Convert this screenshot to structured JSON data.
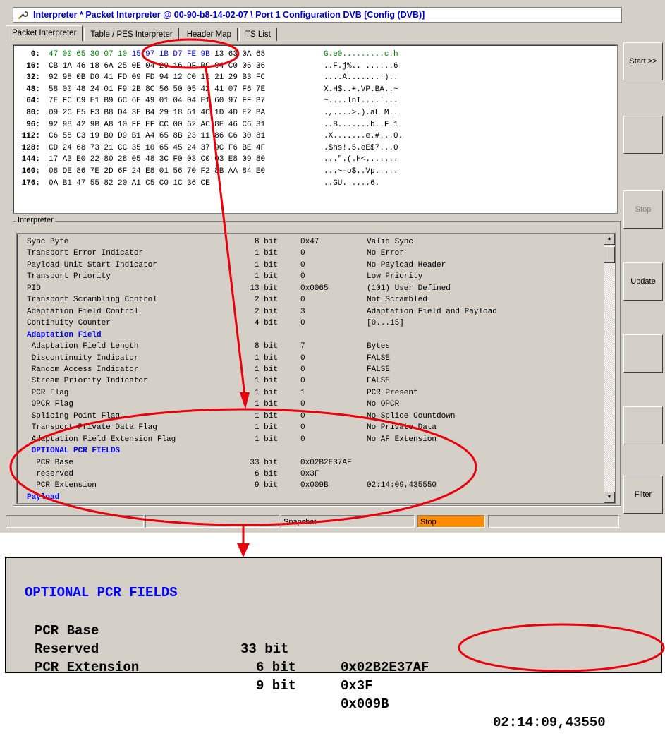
{
  "window": {
    "title": "Interpreter * Packet Interpreter @ 00-90-b8-14-02-07 \\ Port 1 Configuration DVB [Config (DVB)]",
    "tabs": [
      "Packet Interpreter",
      "Table / PES Interpreter",
      "Header Map",
      "TS List"
    ]
  },
  "hex_dump": [
    {
      "offset": "0:",
      "bytes": [
        "47",
        "00",
        "65",
        "30",
        "07",
        "10",
        "15",
        "97",
        "1B",
        "D7",
        "FE",
        "9B",
        "13",
        "63",
        "0A",
        "68"
      ],
      "ascii": "G.e0.........c.h"
    },
    {
      "offset": "16:",
      "bytes": [
        "CB",
        "1A",
        "46",
        "18",
        "6A",
        "25",
        "0E",
        "04",
        "20",
        "16",
        "DF",
        "BC",
        "04",
        "C0",
        "06",
        "36"
      ],
      "ascii": "..F.j%.. ......6"
    },
    {
      "offset": "32:",
      "bytes": [
        "92",
        "98",
        "0B",
        "D0",
        "41",
        "FD",
        "09",
        "FD",
        "94",
        "12",
        "C0",
        "11",
        "21",
        "29",
        "B3",
        "FC"
      ],
      "ascii": "....A.......!).."
    },
    {
      "offset": "48:",
      "bytes": [
        "58",
        "00",
        "48",
        "24",
        "01",
        "F9",
        "2B",
        "8C",
        "56",
        "50",
        "05",
        "42",
        "41",
        "07",
        "F6",
        "7E"
      ],
      "ascii": "X.H$..+.VP.BA..~"
    },
    {
      "offset": "64:",
      "bytes": [
        "7E",
        "FC",
        "C9",
        "E1",
        "B9",
        "6C",
        "6E",
        "49",
        "01",
        "04",
        "04",
        "E1",
        "60",
        "97",
        "FF",
        "B7"
      ],
      "ascii": "~....lnI....`..."
    },
    {
      "offset": "80:",
      "bytes": [
        "09",
        "2C",
        "E5",
        "F3",
        "B8",
        "D4",
        "3E",
        "B4",
        "29",
        "18",
        "61",
        "4C",
        "1D",
        "4D",
        "E2",
        "BA"
      ],
      "ascii": ".,....>.).aL.M.."
    },
    {
      "offset": "96:",
      "bytes": [
        "92",
        "98",
        "42",
        "9B",
        "A8",
        "10",
        "FF",
        "EF",
        "CC",
        "00",
        "62",
        "AC",
        "8E",
        "46",
        "C6",
        "31"
      ],
      "ascii": "..B.......b..F.1"
    },
    {
      "offset": "112:",
      "bytes": [
        "C6",
        "58",
        "C3",
        "19",
        "B0",
        "D9",
        "B1",
        "A4",
        "65",
        "8B",
        "23",
        "11",
        "86",
        "C6",
        "30",
        "81"
      ],
      "ascii": ".X.......e.#...0."
    },
    {
      "offset": "128:",
      "bytes": [
        "CD",
        "24",
        "68",
        "73",
        "21",
        "CC",
        "35",
        "10",
        "65",
        "45",
        "24",
        "37",
        "9C",
        "F6",
        "BE",
        "4F"
      ],
      "ascii": ".$hs!.5.eE$7...0"
    },
    {
      "offset": "144:",
      "bytes": [
        "17",
        "A3",
        "E0",
        "22",
        "80",
        "28",
        "05",
        "48",
        "3C",
        "F0",
        "03",
        "C0",
        "03",
        "E8",
        "09",
        "80"
      ],
      "ascii": "...\".(.H<......."
    },
    {
      "offset": "160:",
      "bytes": [
        "08",
        "DE",
        "86",
        "7E",
        "2D",
        "6F",
        "24",
        "E8",
        "01",
        "56",
        "70",
        "F2",
        "8B",
        "AA",
        "84",
        "E0"
      ],
      "ascii": "...~-o$..Vp....."
    },
    {
      "offset": "176:",
      "bytes": [
        "0A",
        "B1",
        "47",
        "55",
        "82",
        "20",
        "A1",
        "C5",
        "C0",
        "1C",
        "36",
        "CE"
      ],
      "ascii": "..GU. ....6."
    }
  ],
  "side_buttons": [
    "Start >>",
    "",
    "Stop",
    "Update",
    "",
    "",
    "Filter"
  ],
  "interpreter": {
    "label": "Interpreter",
    "rows": [
      {
        "name": "Sync Byte",
        "size": "8 bit",
        "value": "0x47",
        "desc": "Valid Sync"
      },
      {
        "name": "Transport Error Indicator",
        "size": "1 bit",
        "value": "0",
        "desc": "No Error"
      },
      {
        "name": "Payload Unit Start Indicator",
        "size": "1 bit",
        "value": "0",
        "desc": "No Payload Header"
      },
      {
        "name": "Transport Priority",
        "size": "1 bit",
        "value": "0",
        "desc": "Low Priority"
      },
      {
        "name": "PID",
        "size": "13 bit",
        "value": "0x0065",
        "desc": "(101) User Defined"
      },
      {
        "name": "Transport Scrambling Control",
        "size": "2 bit",
        "value": "0",
        "desc": "Not Scrambled"
      },
      {
        "name": "Adaptation Field Control",
        "size": "2 bit",
        "value": "3",
        "desc": "Adaptation Field and Payload"
      },
      {
        "name": "Continuity Counter",
        "size": "4 bit",
        "value": "0",
        "desc": "[0...15]"
      },
      {
        "name": "Adaptation Field",
        "header": true
      },
      {
        "name": " Adaptation Field Length",
        "size": "8 bit",
        "value": "7",
        "desc": "Bytes"
      },
      {
        "name": " Discontinuity Indicator",
        "size": "1 bit",
        "value": "0",
        "desc": "FALSE"
      },
      {
        "name": " Random Access Indicator",
        "size": "1 bit",
        "value": "0",
        "desc": "FALSE"
      },
      {
        "name": " Stream Priority Indicator",
        "size": "1 bit",
        "value": "0",
        "desc": "FALSE"
      },
      {
        "name": " PCR Flag",
        "size": "1 bit",
        "value": "1",
        "desc": "PCR Present"
      },
      {
        "name": " OPCR Flag",
        "size": "1 bit",
        "value": "0",
        "desc": "No OPCR"
      },
      {
        "name": " Splicing Point Flag",
        "size": "1 bit",
        "value": "0",
        "desc": "No Splice Countdown"
      },
      {
        "name": " Transport Private Data Flag",
        "size": "1 bit",
        "value": "0",
        "desc": "No Private Data"
      },
      {
        "name": " Adaptation Field Extension Flag",
        "size": "1 bit",
        "value": "0",
        "desc": "No AF Extension"
      },
      {
        "name": " OPTIONAL PCR FIELDS",
        "header": true
      },
      {
        "name": "  PCR Base",
        "size": "33 bit",
        "value": "0x02B2E37AF",
        "desc": ""
      },
      {
        "name": "  reserved",
        "size": "6 bit",
        "value": "0x3F",
        "desc": ""
      },
      {
        "name": "  PCR Extension",
        "size": "9 bit",
        "value": "0x009B",
        "desc": "02:14:09,435550"
      },
      {
        "name": "Payload",
        "header": true
      }
    ]
  },
  "status": {
    "snapshot": "Snapshot",
    "stop": "Stop",
    "stop_color": "#ff8c00"
  },
  "zoom": {
    "title": "OPTIONAL PCR FIELDS",
    "rows": [
      {
        "name": "PCR Base",
        "size": "33 bit",
        "value": "0x02B2E37AF",
        "desc": ""
      },
      {
        "name": "Reserved",
        "size": "6 bit",
        "value": "0x3F",
        "desc": ""
      },
      {
        "name": "PCR Extension",
        "size": "9 bit",
        "value": "0x009B",
        "desc": "02:14:09,43550"
      }
    ]
  },
  "colors": {
    "annotation": "#e8000d",
    "header_text": "#0000ff",
    "sync_bytes": "#008000",
    "pcr_bytes": "#0000ff"
  }
}
